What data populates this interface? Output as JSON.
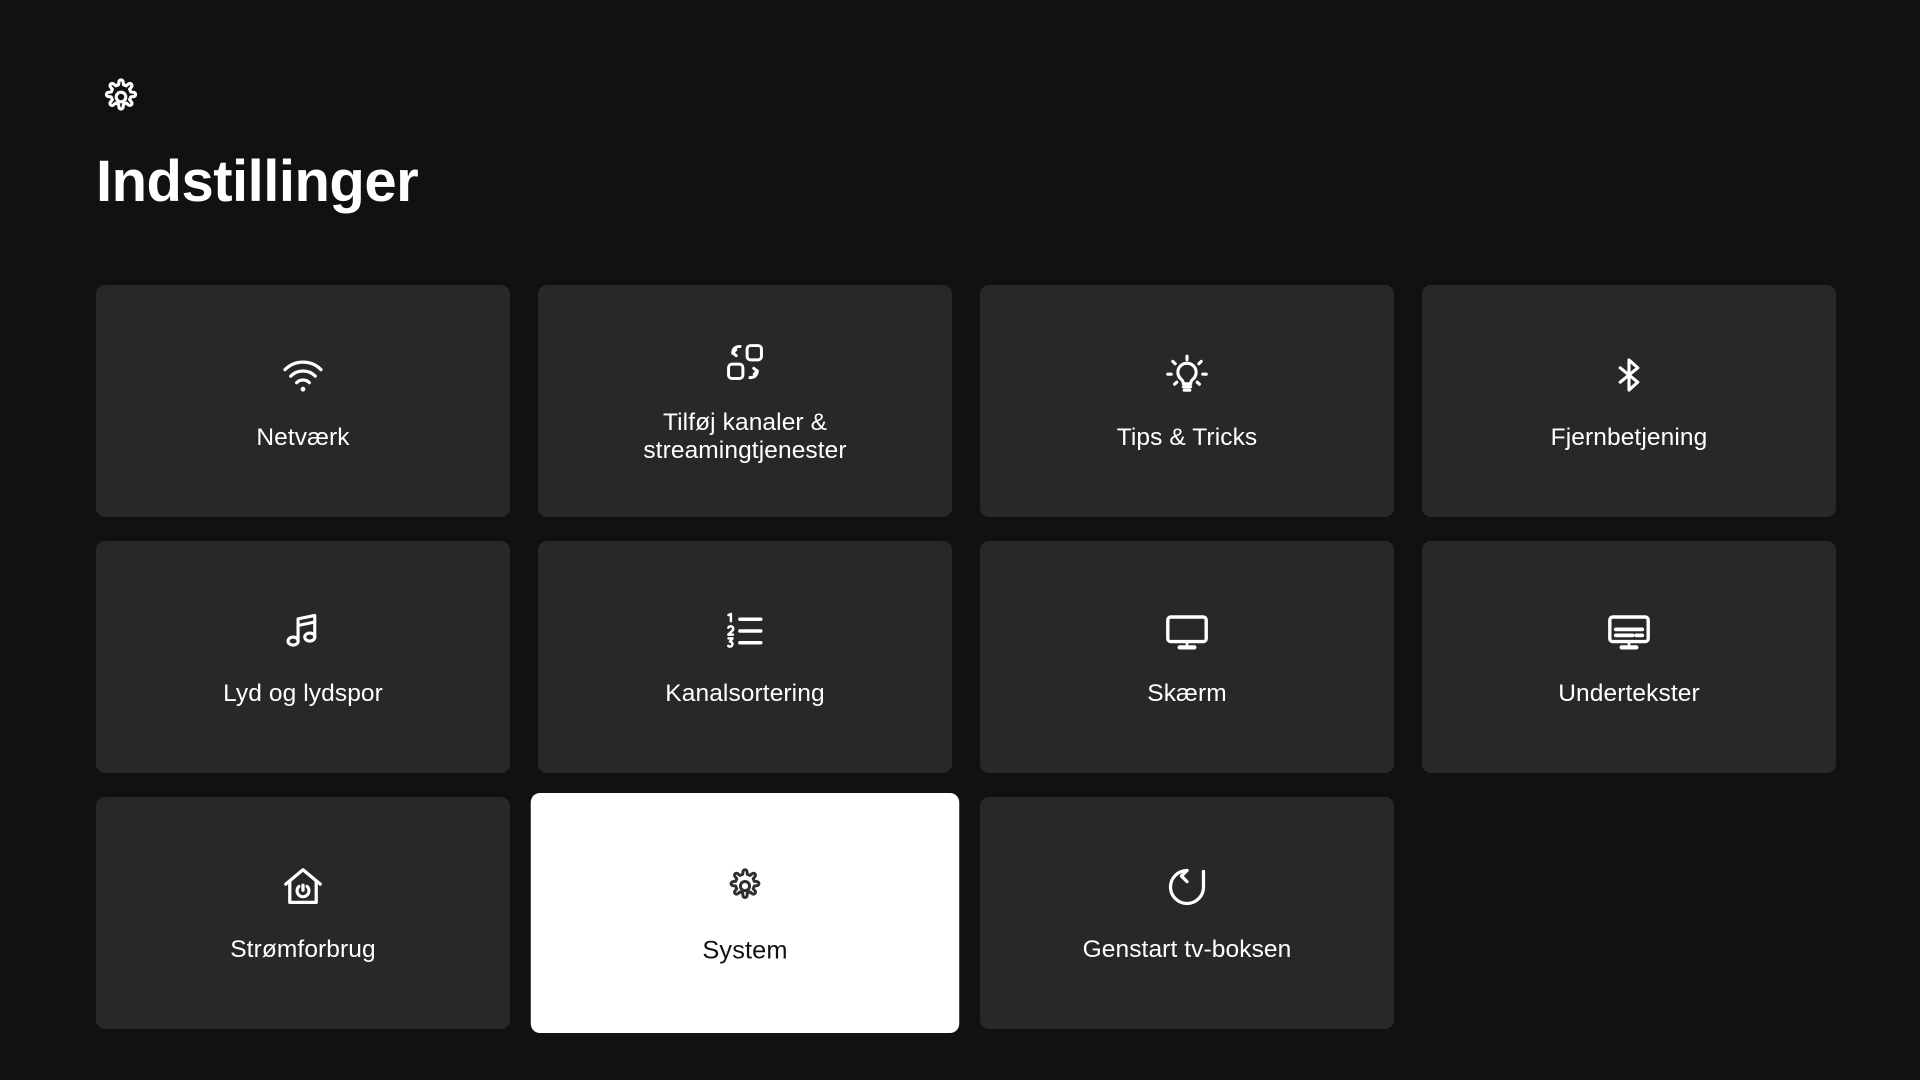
{
  "header": {
    "icon": "gear-icon",
    "title": "Indstillinger"
  },
  "colors": {
    "background": "#111111",
    "tile": "#282828",
    "tile_selected": "#ffffff",
    "text": "#ffffff",
    "text_selected": "#111111"
  },
  "grid": {
    "columns": 4,
    "tiles": [
      {
        "id": "netvaerk",
        "label": "Netværk",
        "icon": "wifi-icon",
        "selected": false,
        "lines": 1
      },
      {
        "id": "tilfoej-kanaler",
        "label": "Tilføj kanaler & streamingtjenester",
        "icon": "add-channels-icon",
        "selected": false,
        "lines": 2
      },
      {
        "id": "tips-tricks",
        "label": "Tips & Tricks",
        "icon": "lightbulb-icon",
        "selected": false,
        "lines": 1
      },
      {
        "id": "fjernbetjening",
        "label": "Fjernbetjening",
        "icon": "bluetooth-icon",
        "selected": false,
        "lines": 1
      },
      {
        "id": "lyd-og-lydspor",
        "label": "Lyd og lydspor",
        "icon": "music-note-icon",
        "selected": false,
        "lines": 1
      },
      {
        "id": "kanalsortering",
        "label": "Kanalsortering",
        "icon": "numbered-list-icon",
        "selected": false,
        "lines": 1
      },
      {
        "id": "skaerm",
        "label": "Skærm",
        "icon": "monitor-icon",
        "selected": false,
        "lines": 1
      },
      {
        "id": "undertekster",
        "label": "Undertekster",
        "icon": "subtitles-icon",
        "selected": false,
        "lines": 1
      },
      {
        "id": "stroemforbrug",
        "label": "Strømforbrug",
        "icon": "home-power-icon",
        "selected": false,
        "lines": 1
      },
      {
        "id": "system",
        "label": "System",
        "icon": "gear-icon",
        "selected": true,
        "lines": 1
      },
      {
        "id": "genstart-tv-boksen",
        "label": "Genstart tv-boksen",
        "icon": "restart-icon",
        "selected": false,
        "lines": 1
      }
    ]
  }
}
